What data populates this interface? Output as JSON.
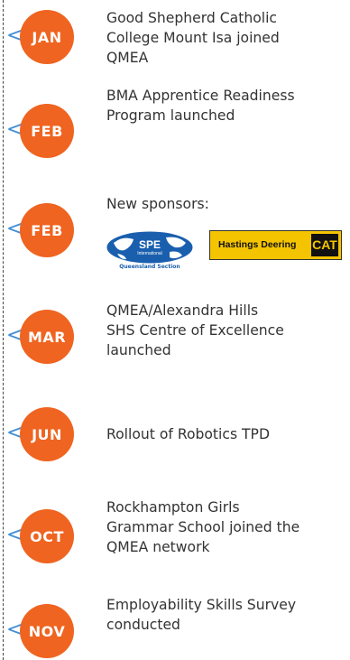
{
  "timeline": {
    "entries": [
      {
        "month": "JAN",
        "lines": [
          "Good Shepherd Catholic",
          "College Mount Isa joined",
          "QMEA"
        ]
      },
      {
        "month": "FEB",
        "lines": [
          "BMA Apprentice Readiness",
          "Program launched"
        ]
      },
      {
        "month": "FEB",
        "lines": [
          "New sponsors:"
        ]
      },
      {
        "month": "MAR",
        "lines": [
          "QMEA/Alexandra Hills",
          "SHS Centre of Excellence",
          "launched"
        ]
      },
      {
        "month": "JUN",
        "lines": [
          "Rollout of Robotics TPD"
        ]
      },
      {
        "month": "OCT",
        "lines": [
          "Rockhampton Girls",
          "Grammar School joined the",
          "QMEA network"
        ]
      },
      {
        "month": "NOV",
        "lines": [
          "Employability Skills Survey",
          "conducted"
        ]
      }
    ],
    "arrow_glyph": "<",
    "sponsors": {
      "spe": {
        "name": "SPE",
        "sub": "International",
        "caption": "Queensland Section"
      },
      "hastings": {
        "name": "Hastings Deering",
        "mark": "CAT"
      }
    }
  },
  "colors": {
    "badge": "#ef6420",
    "arrow": "#3f8ed8",
    "text": "#333333",
    "spe_blue": "#1a5fae",
    "cat_yellow": "#f4c400"
  }
}
